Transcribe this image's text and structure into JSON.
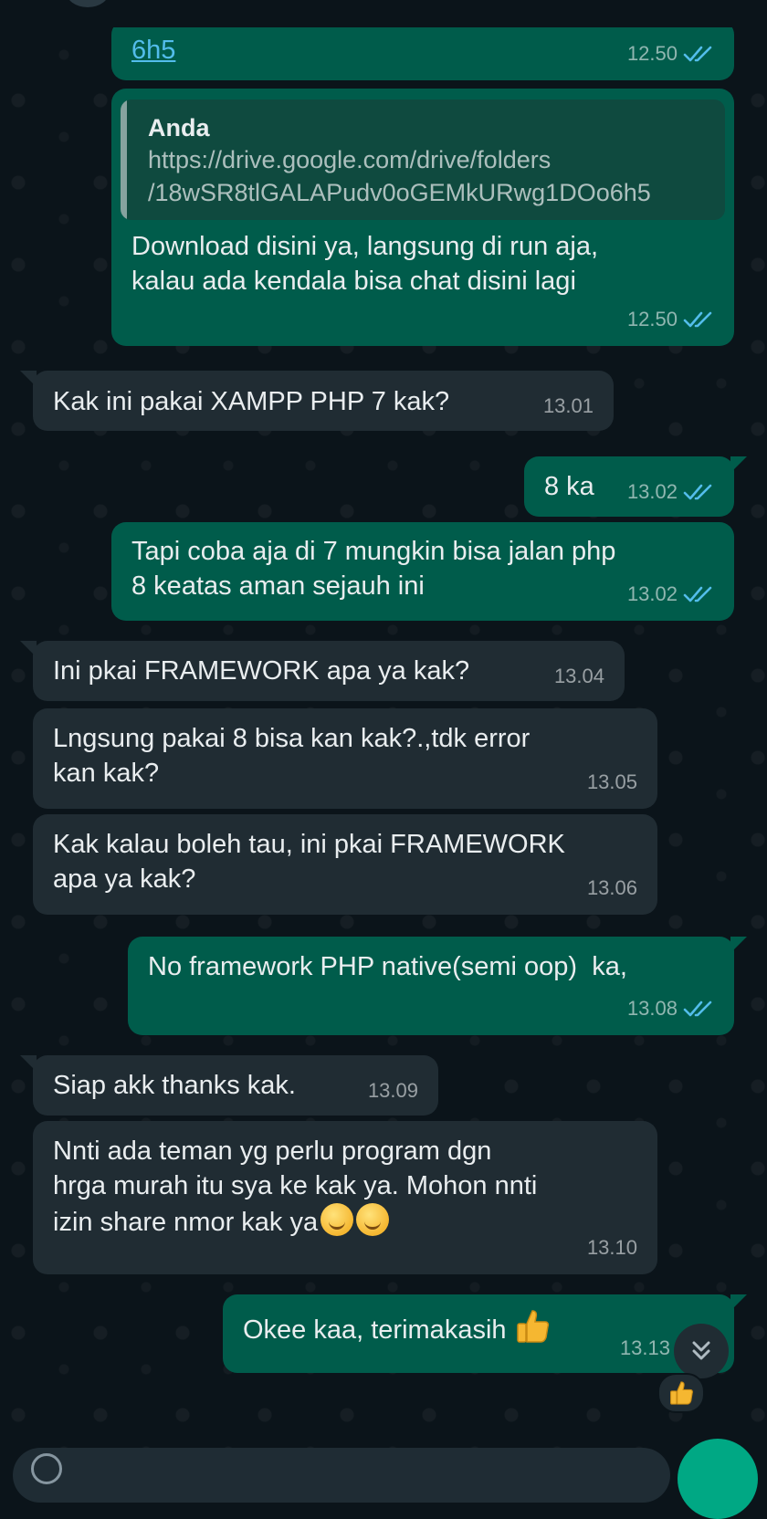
{
  "messages": [
    {
      "id": "m1",
      "direction": "out",
      "text": "6h5",
      "time": "12.50",
      "status": "read"
    },
    {
      "id": "m2",
      "direction": "out",
      "quote": {
        "author": "Anda",
        "text": "https://drive.google.com/drive/folders\n/18wSR8tlGALAPudv0oGEMkURwg1DOo6h5"
      },
      "text": "Download disini ya, langsung di run aja,\nkalau ada kendala bisa chat disini lagi",
      "time": "12.50",
      "status": "read"
    },
    {
      "id": "m3",
      "direction": "in",
      "text": "Kak ini pakai XAMPP PHP 7 kak?",
      "time": "13.01"
    },
    {
      "id": "m4",
      "direction": "out",
      "text": "8 ka",
      "time": "13.02",
      "status": "read"
    },
    {
      "id": "m5",
      "direction": "out",
      "text": "Tapi coba aja di 7 mungkin bisa jalan php\n8 keatas aman sejauh ini",
      "time": "13.02",
      "status": "read"
    },
    {
      "id": "m6",
      "direction": "in",
      "text": "Ini pkai FRAMEWORK apa ya kak?",
      "time": "13.04"
    },
    {
      "id": "m7",
      "direction": "in",
      "text": "Lngsung pakai 8 bisa kan kak?.,tdk error\nkan kak?",
      "time": "13.05"
    },
    {
      "id": "m8",
      "direction": "in",
      "text": "Kak kalau boleh tau, ini pkai FRAMEWORK\napa ya kak?",
      "time": "13.06"
    },
    {
      "id": "m9",
      "direction": "out",
      "text": "No framework PHP native(semi oop)  ka,",
      "time": "13.08",
      "status": "read"
    },
    {
      "id": "m10",
      "direction": "in",
      "text": "Siap akk thanks kak.",
      "time": "13.09"
    },
    {
      "id": "m11",
      "direction": "in",
      "text": "Nnti ada teman yg perlu program dgn\nhrga murah itu sya ke kak ya. Mohon nnti\nizin share nmor kak ya",
      "emojis": [
        "smiling-face-icon",
        "smiling-face-icon"
      ],
      "time": "13.10"
    },
    {
      "id": "m12",
      "direction": "out",
      "text": "Okee kaa, terimakasih",
      "emoji": "thumbs-up-icon",
      "time": "13.13",
      "reaction": "thumbs-up-icon"
    }
  ],
  "controls": {
    "scroll_to_bottom_icon": "double-chevron-down-icon",
    "mic_icon": "microphone-icon"
  },
  "colors": {
    "background": "#0b141a",
    "incoming_bubble": "#202c33",
    "outgoing_bubble": "#005c4b",
    "read_ticks": "#53bdeb",
    "link": "#53bdeb",
    "accent": "#00a884"
  }
}
